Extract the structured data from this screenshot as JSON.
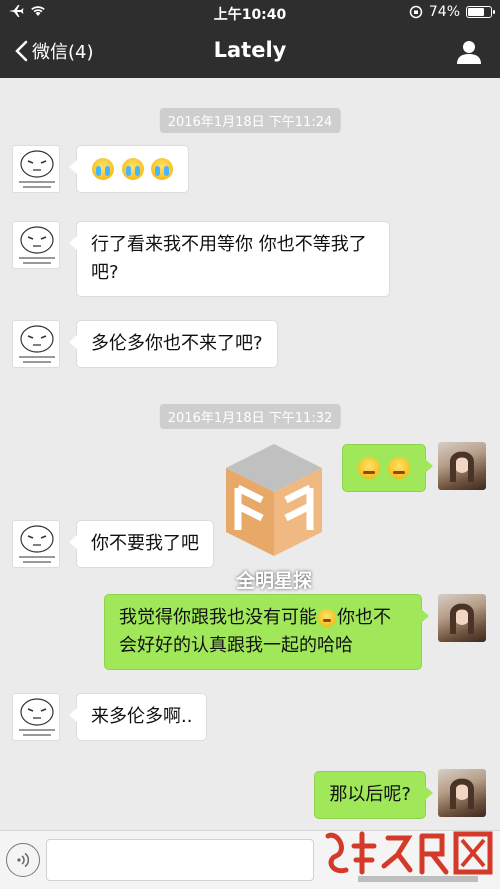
{
  "status_bar": {
    "time": "上午10:40",
    "battery_percent": "74%",
    "battery_level": 0.74
  },
  "nav": {
    "back_label": "微信(4)",
    "title": "Lately"
  },
  "timestamps": [
    "2016年1月18日 下午11:24",
    "2016年1月18日 下午11:32"
  ],
  "messages": [
    {
      "side": "left",
      "text": "",
      "emoji": [
        "cry-face-icon",
        "cry-face-icon",
        "cry-face-icon"
      ]
    },
    {
      "side": "left",
      "text": "行了看来我不用等你 你也不等我了吧?"
    },
    {
      "side": "left",
      "text": "多伦多你也不来了吧?"
    },
    {
      "side": "right",
      "text": "",
      "emoji": [
        "angry-face-icon",
        "angry-face-icon"
      ]
    },
    {
      "side": "left",
      "text": "你不要我了吧"
    },
    {
      "side": "right",
      "text_before": "我觉得你跟我也没有可能",
      "text_after": "你也不会好好的认真跟我一起的哈哈"
    },
    {
      "side": "left",
      "text": "来多伦多啊.."
    },
    {
      "side": "right",
      "text": "那以后呢?"
    }
  ],
  "watermark": {
    "label": "全明星探"
  },
  "input": {
    "placeholder": ""
  },
  "colors": {
    "nav_bg": "#2e2e2e",
    "chat_bg": "#ebebeb",
    "bubble_sent": "#a0e75a",
    "bubble_received": "#ffffff",
    "logo_red": "#d43a2a"
  }
}
